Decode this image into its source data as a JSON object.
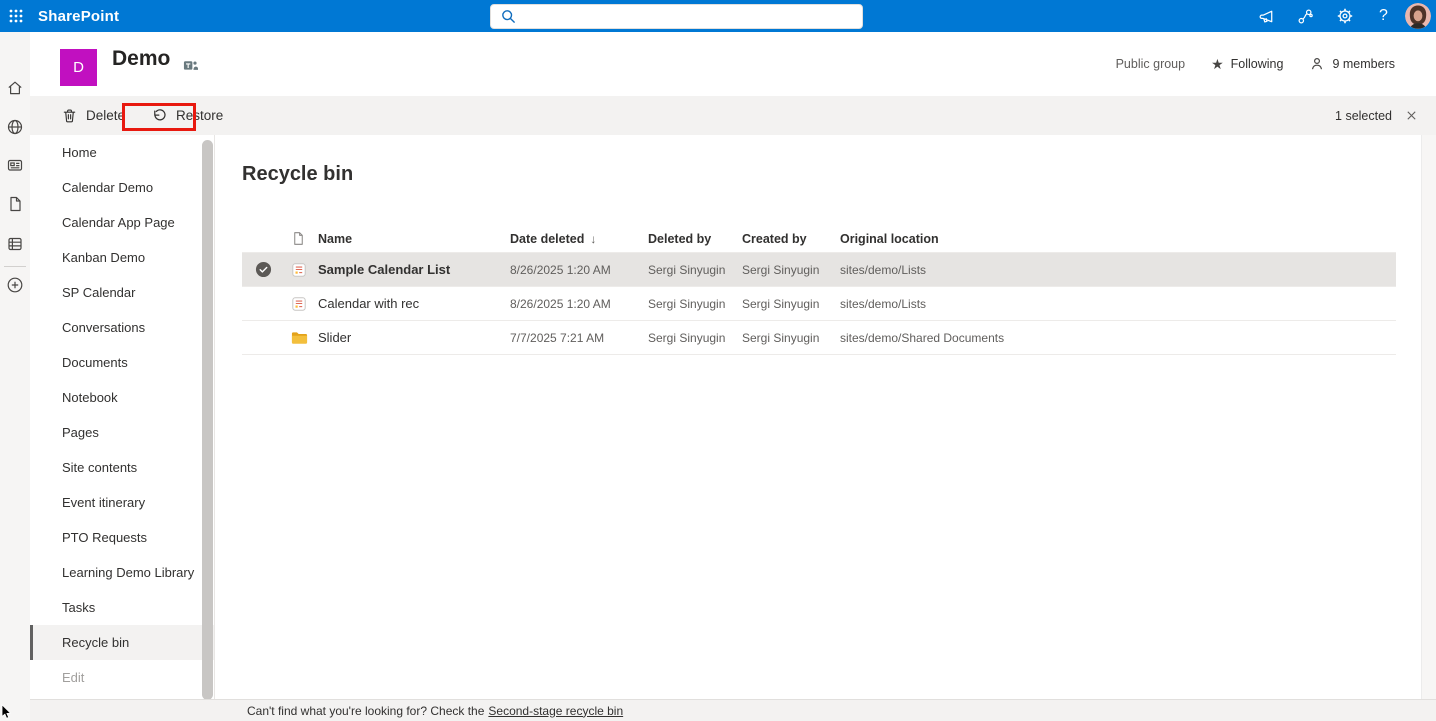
{
  "suite_bar": {
    "app_name": "SharePoint",
    "search": {
      "value": "",
      "placeholder": ""
    }
  },
  "site_header": {
    "logo_letter": "D",
    "title": "Demo",
    "privacy": "Public group",
    "following_label": "Following",
    "members_label": "9 members"
  },
  "command_bar": {
    "delete_label": "Delete",
    "restore_label": "Restore",
    "selection_status": "1 selected"
  },
  "sidebar": {
    "items": [
      {
        "label": "Home"
      },
      {
        "label": "Calendar Demo"
      },
      {
        "label": "Calendar App Page"
      },
      {
        "label": "Kanban Demo"
      },
      {
        "label": "SP Calendar"
      },
      {
        "label": "Conversations"
      },
      {
        "label": "Documents"
      },
      {
        "label": "Notebook"
      },
      {
        "label": "Pages"
      },
      {
        "label": "Site contents"
      },
      {
        "label": "Event itinerary"
      },
      {
        "label": "PTO Requests"
      },
      {
        "label": "Learning Demo Library"
      },
      {
        "label": "Tasks"
      },
      {
        "label": "Recycle bin",
        "selected": true
      },
      {
        "label": "Edit",
        "disabled": true
      }
    ]
  },
  "main": {
    "title": "Recycle bin",
    "table": {
      "columns": [
        "Name",
        "Date deleted",
        "Deleted by",
        "Created by",
        "Original location"
      ],
      "sort_indicator": "↓",
      "rows": [
        {
          "icon": "list",
          "name": "Sample Calendar List",
          "date_deleted": "8/26/2025 1:20 AM",
          "deleted_by": "Sergi Sinyugin",
          "created_by": "Sergi Sinyugin",
          "original_location": "sites/demo/Lists",
          "selected": true
        },
        {
          "icon": "list",
          "name": "Calendar with rec",
          "date_deleted": "8/26/2025 1:20 AM",
          "deleted_by": "Sergi Sinyugin",
          "created_by": "Sergi Sinyugin",
          "original_location": "sites/demo/Lists",
          "selected": false
        },
        {
          "icon": "folder",
          "name": "Slider",
          "date_deleted": "7/7/2025 7:21 AM",
          "deleted_by": "Sergi Sinyugin",
          "created_by": "Sergi Sinyugin",
          "original_location": "sites/demo/Shared Documents",
          "selected": false
        }
      ]
    },
    "footer": {
      "prefix": "Can't find what you're looking for? Check the",
      "link": "Second-stage recycle bin"
    }
  },
  "icons": {
    "app_launcher": "waffle-grid",
    "search": "magnifier",
    "announcements": "megaphone",
    "connections": "linked-nodes",
    "settings": "gear",
    "help": "question-mark",
    "profile": "avatar-photo",
    "rail": [
      "home",
      "globe",
      "news",
      "document",
      "lists",
      "add"
    ],
    "delete": "trash",
    "restore": "undo-arrow",
    "following": "star-filled",
    "members": "person",
    "clear_selection": "x",
    "sorted_desc": "down-arrow",
    "selected_row": "check-circle",
    "row_types": {
      "list": "sharepoint-list",
      "folder": "folder"
    }
  },
  "colors": {
    "suite_bar": "#0078d4",
    "site_logo": "#c110c0",
    "annotation": "#e8190f",
    "selected_row": "#e6e4e2",
    "folder": "#f3bf3c",
    "command_bar": "#f3f2f1"
  }
}
